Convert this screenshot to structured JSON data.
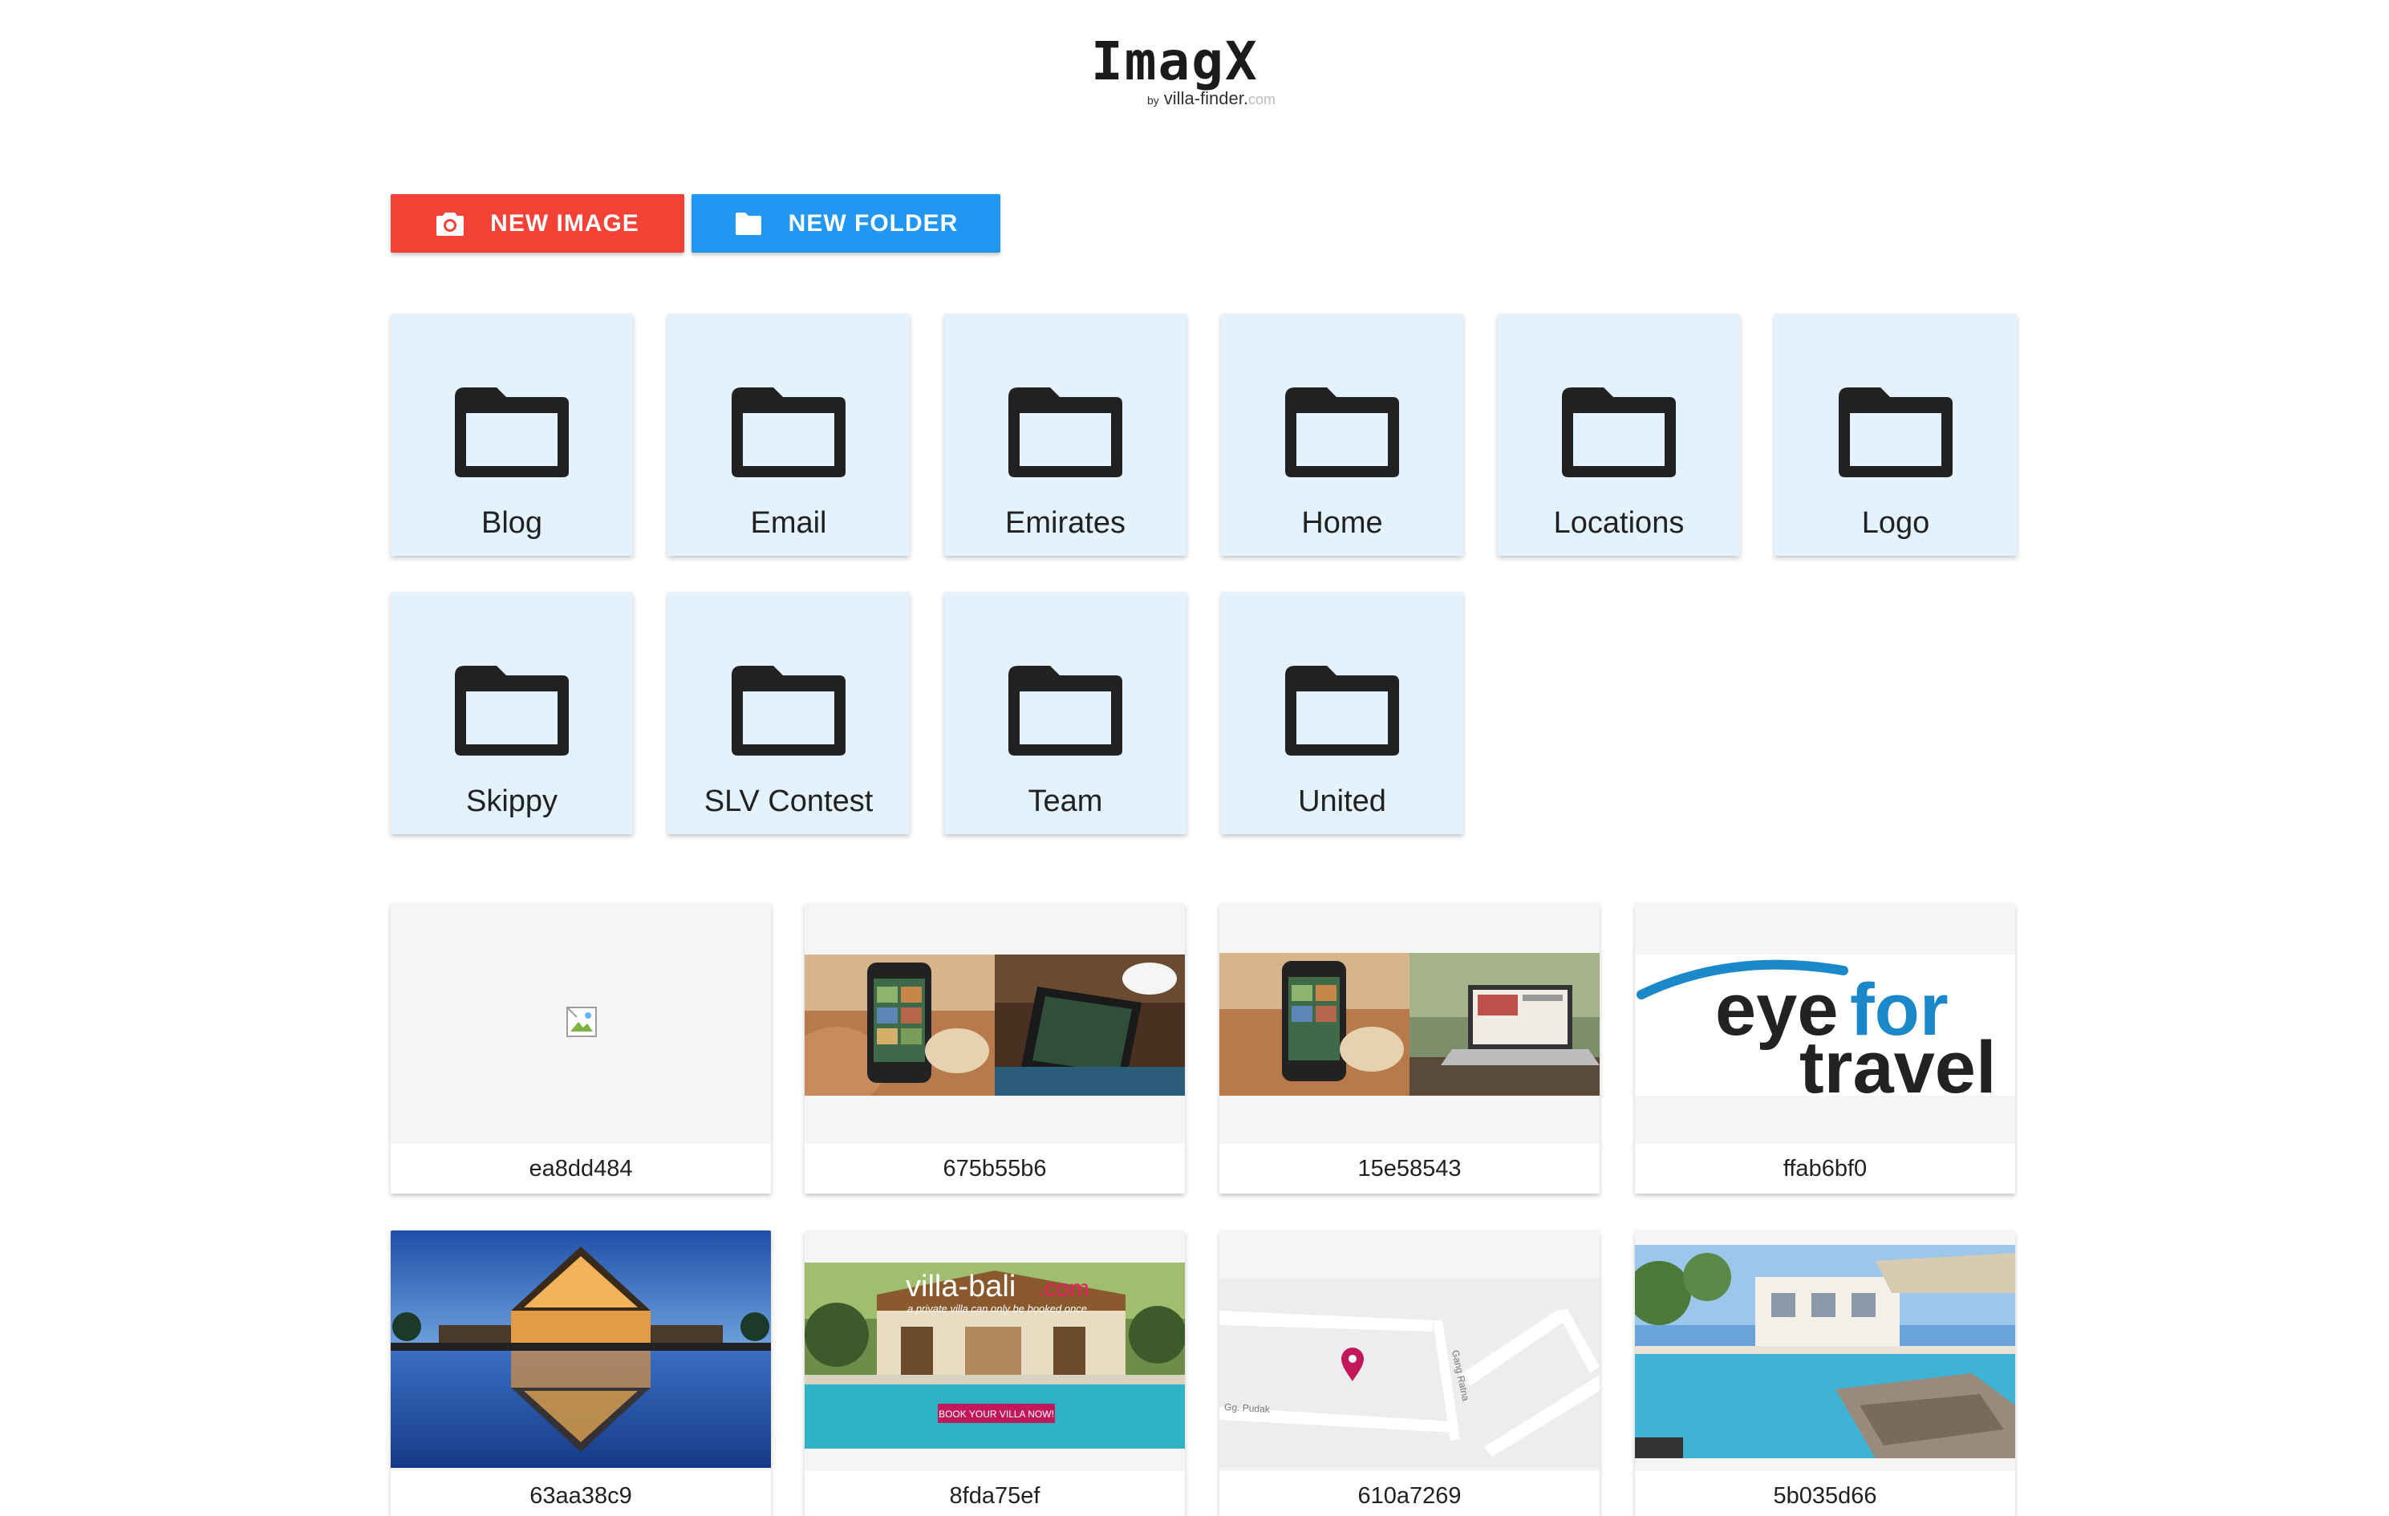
{
  "logo": {
    "title": "ImagX",
    "by": "by",
    "brand": "villa-finder",
    "dot": ".",
    "tld": "com"
  },
  "actions": {
    "new_image": "NEW IMAGE",
    "new_folder": "NEW FOLDER",
    "new_image_color": "#f44336",
    "new_folder_color": "#2196f3"
  },
  "folders": [
    {
      "label": "Blog"
    },
    {
      "label": "Email"
    },
    {
      "label": "Emirates"
    },
    {
      "label": "Home"
    },
    {
      "label": "Locations"
    },
    {
      "label": "Logo"
    },
    {
      "label": "Skippy"
    },
    {
      "label": "SLV Contest"
    },
    {
      "label": "Team"
    },
    {
      "label": "United"
    }
  ],
  "images": [
    {
      "id": "ea8dd484",
      "thumb": "broken-image-icon"
    },
    {
      "id": "675b55b6",
      "thumb": "phone-tablet-photo"
    },
    {
      "id": "15e58543",
      "thumb": "phone-laptop-photo"
    },
    {
      "id": "ffab6bf0",
      "thumb": "eyefortravel-logo",
      "logo_text_1": "eye",
      "logo_text_2": "for",
      "logo_text_3": "travel"
    },
    {
      "id": "63aa38c9",
      "thumb": "villa-pool-dusk-photo"
    },
    {
      "id": "8fda75ef",
      "thumb": "villa-bali-banner",
      "brand": "villa-bali",
      "tld": ".com",
      "tagline": "a private villa can only be booked once",
      "cta": "BOOK YOUR VILLA NOW!"
    },
    {
      "id": "610a7269",
      "thumb": "map",
      "street_1": "Gang Ratna",
      "street_2": "Gg. Pudak"
    },
    {
      "id": "5b035d66",
      "thumb": "villa-pool-daylight-photo"
    }
  ]
}
